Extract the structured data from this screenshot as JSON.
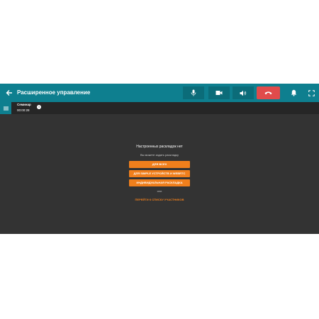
{
  "header": {
    "title": "Расширенное управление"
  },
  "icons": {
    "back": "arrow-left-icon",
    "mic": "microphone-icon",
    "camera": "video-camera-icon",
    "speaker": "speaker-icon",
    "hangup": "phone-hangup-icon",
    "bell": "bell-icon",
    "fullscreen": "fullscreen-icon",
    "menu": "list-icon",
    "info": "info-icon"
  },
  "conference": {
    "name": "Семинар",
    "timer": "00:00:28"
  },
  "empty_state": {
    "title": "Настроенных раскладок нет",
    "subtitle": "Вы можете задать раскладку",
    "buttons": [
      "для всех",
      "для simple устройств и webrtc",
      "индивидуальная раскладка"
    ],
    "or": "или",
    "link": "ПЕРЕЙТИ К СПИСКУ УЧАСТНИКОВ"
  },
  "colors": {
    "topbar": "#0e7f8f",
    "body": "#333333",
    "accent": "#f07f1c",
    "hangup": "#e04b4b"
  }
}
